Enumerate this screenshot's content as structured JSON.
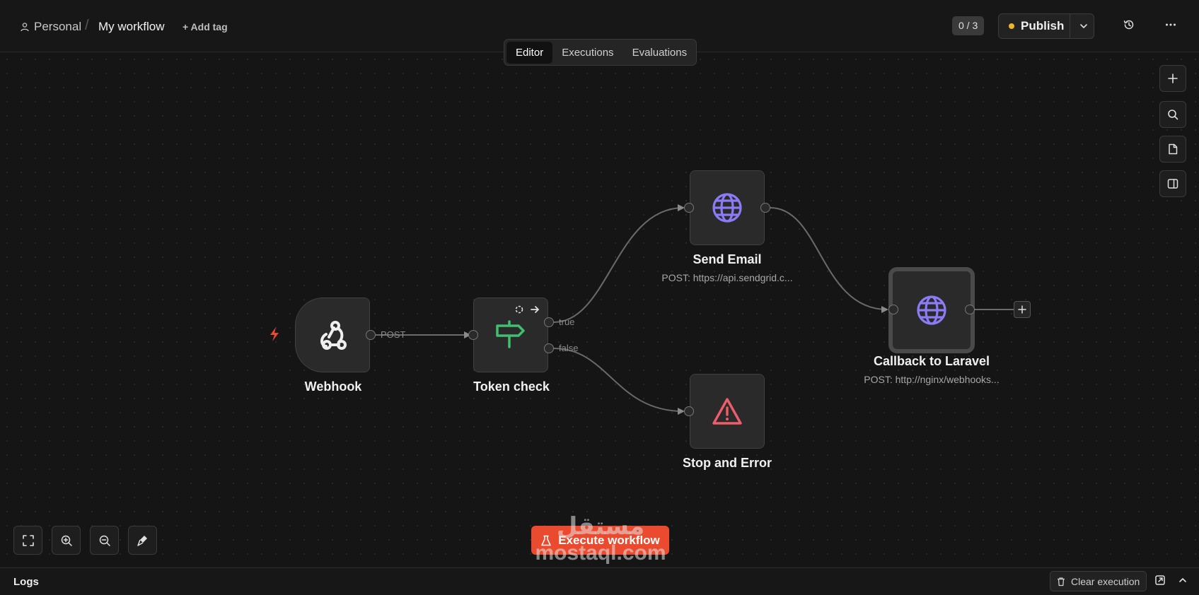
{
  "header": {
    "breadcrumb_project": "Personal",
    "breadcrumb_separator": "/",
    "workflow_title": "My workflow",
    "add_tag": "+ Add tag",
    "counter": "0 / 3",
    "publish_label": "Publish",
    "publish_status_color": "#f0b429",
    "icons": [
      "user-icon",
      "history-icon",
      "more-icon",
      "chevron-down-icon"
    ]
  },
  "tabs": [
    {
      "label": "Editor",
      "active": true
    },
    {
      "label": "Executions",
      "active": false
    },
    {
      "label": "Evaluations",
      "active": false
    }
  ],
  "right_toolbar": [
    "plus-icon",
    "search-icon",
    "sticky-note-icon",
    "panel-icon"
  ],
  "nodes": {
    "webhook": {
      "title": "Webhook",
      "icon": "webhook-icon"
    },
    "token_check": {
      "title": "Token check",
      "icon": "signpost-icon"
    },
    "send_email": {
      "title": "Send Email",
      "subtitle": "POST: https://api.sendgrid.c...",
      "icon": "globe-icon"
    },
    "stop_error": {
      "title": "Stop and Error",
      "icon": "warning-icon"
    },
    "callback": {
      "title": "Callback to Laravel",
      "subtitle": "POST: http://nginx/webhooks...",
      "icon": "globe-icon"
    }
  },
  "edge_labels": {
    "webhook_out": "POST",
    "if_true": "true",
    "if_false": "false"
  },
  "bottom_tools": [
    "fit-view-icon",
    "zoom-in-icon",
    "zoom-out-icon",
    "tidy-up-icon"
  ],
  "execute_button": "Execute workflow",
  "watermark": {
    "arabic": "مستقل",
    "latin": "mostaql.com"
  },
  "logs": {
    "title": "Logs",
    "clear_button": "Clear execution"
  },
  "colors": {
    "accent": "#ea4b2f",
    "globe": "#8b7cf6",
    "if_green": "#3fbf6f",
    "error_red": "#ef5d6b"
  }
}
